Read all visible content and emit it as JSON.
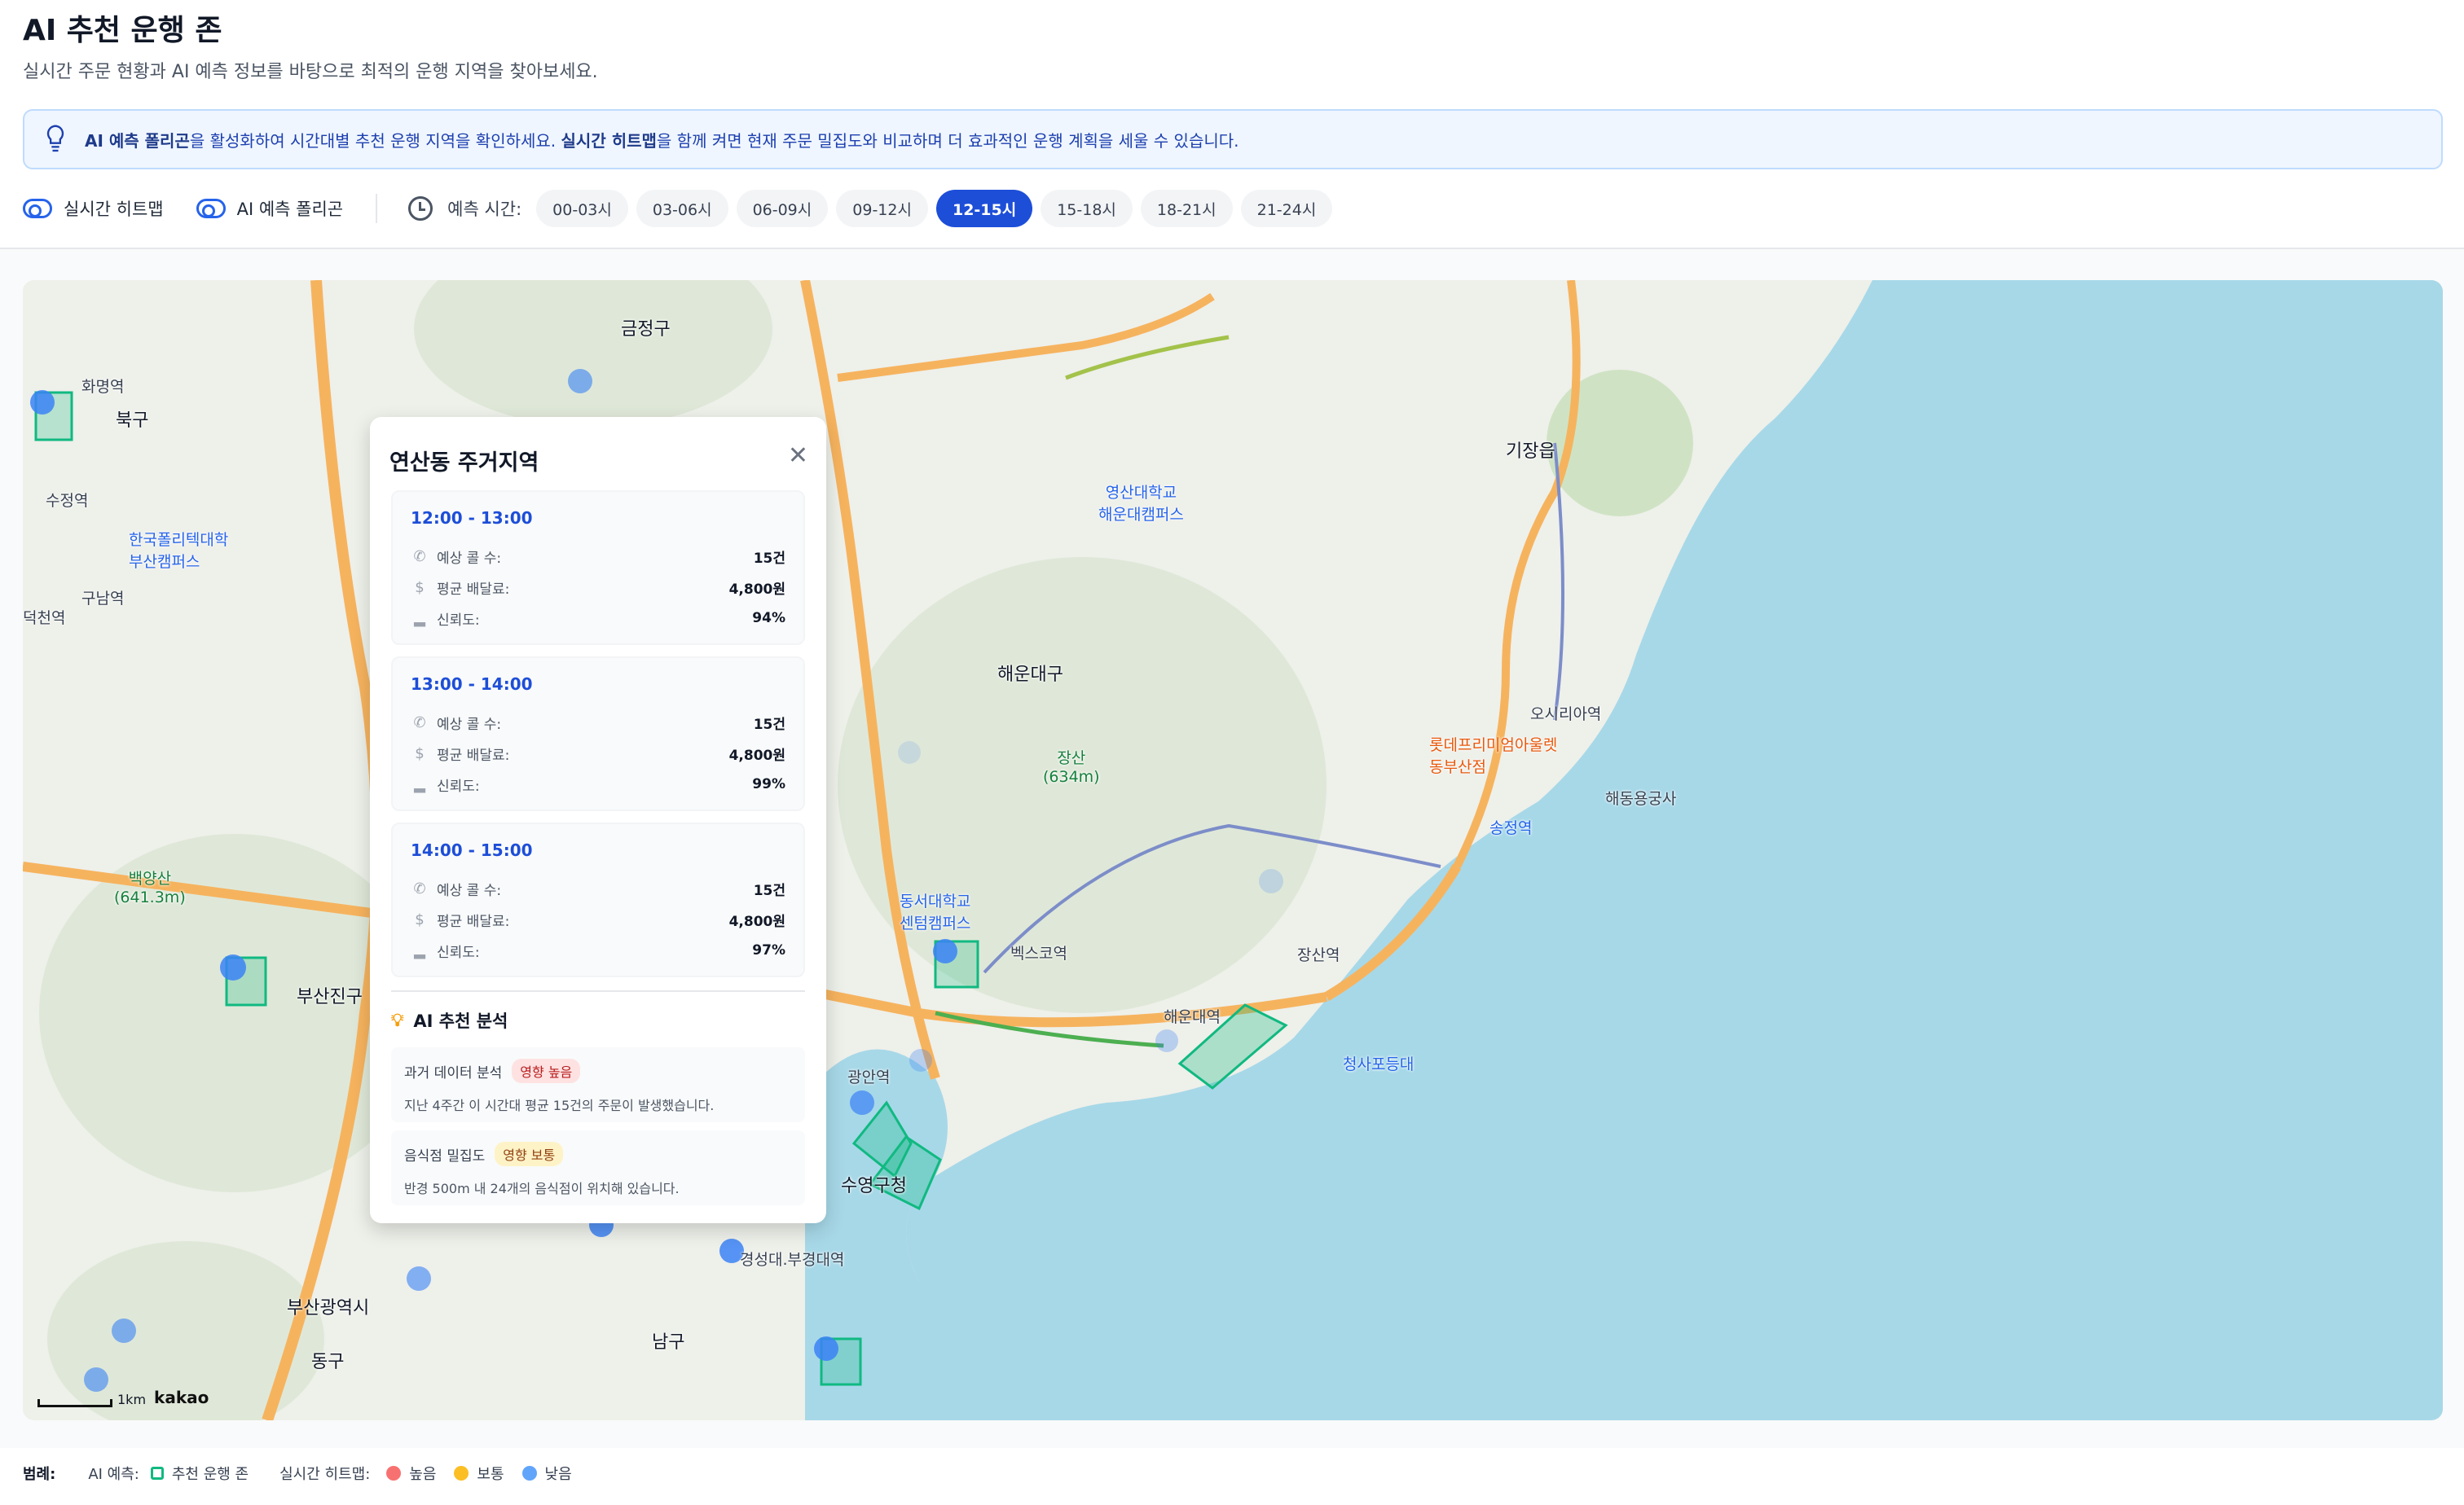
{
  "header": {
    "title": "AI 추천 운행 존",
    "subtitle": "실시간 주문 현황과 AI 예측 정보를 바탕으로 최적의 운행 지역을 찾아보세요."
  },
  "banner": {
    "strong1": "AI 예측 폴리곤",
    "text1": "을 활성화하여 시간대별 추천 운행 지역을 확인하세요. ",
    "strong2": "실시간 히트맵",
    "text2": "을 함께 켜면 현재 주문 밀집도와 비교하며 더 효과적인 운행 계획을 세울 수 있습니다."
  },
  "controls": {
    "toggle_heatmap": "실시간 히트맵",
    "toggle_polygon": "AI 예측 폴리곤",
    "time_label": "예측 시간:",
    "chips": [
      "00-03시",
      "03-06시",
      "06-09시",
      "09-12시",
      "12-15시",
      "15-18시",
      "18-21시",
      "21-24시"
    ],
    "active_chip": "12-15시"
  },
  "map": {
    "labels": {
      "geumjeong": "금정구",
      "buk": "북구",
      "haeundae": "해운대구",
      "gijang": "기장읍",
      "yeonje": "연산동",
      "busanjin": "부산진구",
      "busan_city": "부산광역시",
      "dong": "동구",
      "nam": "남구",
      "suyeong": "수영구청",
      "haeundae_univ": "영산대학교\n해운대캠퍼스",
      "jangsan": "장산\n(634m)",
      "baekyang": "백양산\n(641.3m)",
      "lotte": "롯데프리미엄아울렛\n동부산점",
      "cheongsapo": "청사포등대",
      "hwamyeong": "화명역",
      "suseong": "수정역",
      "deokcheon": "덕천역",
      "gumyeong": "구남역",
      "hanguk": "한국폴리텍대학\n부산캠퍼스",
      "dongseo": "동서대학교\n센텀캠퍼스",
      "bexco": "벡스코역",
      "jangsan_st": "장산역",
      "haeundae_st": "해운대역",
      "gwangan": "광안역",
      "kyungsung": "경성대.부경대역",
      "songjeong": "송정역",
      "osiria": "오시리아역",
      "yonggungsa": "해동용궁사",
      "scale": "1km",
      "brand": "kakao"
    }
  },
  "popup": {
    "title": "연산동 주거지역",
    "slots": [
      {
        "time": "12:00 - 13:00",
        "calls_label": "예상 콜 수:",
        "calls": "15건",
        "fee_label": "평균 배달료:",
        "fee": "4,800원",
        "conf_label": "신뢰도:",
        "conf": "94%"
      },
      {
        "time": "13:00 - 14:00",
        "calls_label": "예상 콜 수:",
        "calls": "15건",
        "fee_label": "평균 배달료:",
        "fee": "4,800원",
        "conf_label": "신뢰도:",
        "conf": "99%"
      },
      {
        "time": "14:00 - 15:00",
        "calls_label": "예상 콜 수:",
        "calls": "15건",
        "fee_label": "평균 배달료:",
        "fee": "4,800원",
        "conf_label": "신뢰도:",
        "conf": "97%"
      }
    ],
    "analysis_title": "AI 추천 분석",
    "analysis": [
      {
        "name": "과거 데이터 분석",
        "badge": "영향 높음",
        "desc": "지난 4주간 이 시간대 평균 15건의 주문이 발생했습니다."
      },
      {
        "name": "음식점 밀집도",
        "badge": "영향 보통",
        "desc": "반경 500m 내 24개의 음식점이 위치해 있습니다."
      }
    ]
  },
  "legend": {
    "title": "범례:",
    "ai_label": "AI 예측:",
    "ai_zone": "추천 운행 존",
    "heat_label": "실시간 히트맵:",
    "high": "높음",
    "mid": "보통",
    "low": "낮음",
    "colors": {
      "high": "#f87171",
      "mid": "#fbbf24",
      "low": "#60a5fa",
      "zone": "#10b981"
    }
  }
}
